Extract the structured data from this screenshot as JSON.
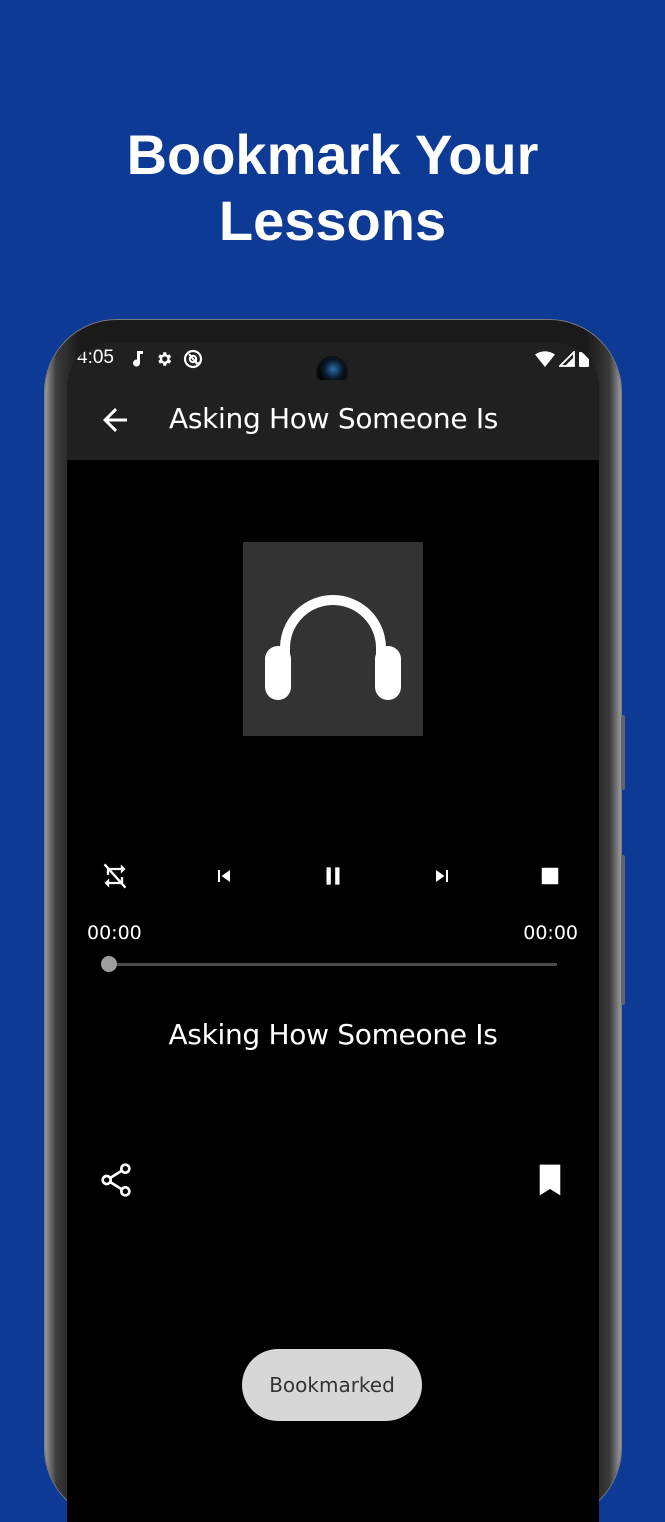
{
  "promo": {
    "headline_line1": "Bookmark Your",
    "headline_line2": "Lessons",
    "background_color": "#0c3a94"
  },
  "status_bar": {
    "time": "4:05",
    "left_icons": [
      "music-note-icon",
      "gear-icon",
      "at-sign-icon"
    ],
    "right_icons": [
      "wifi-icon",
      "cellular-signal-icon",
      "battery-icon"
    ]
  },
  "app_bar": {
    "back_icon": "arrow-left-icon",
    "title": "Asking How Someone Is"
  },
  "player": {
    "artwork_icon": "headphones-icon",
    "controls": [
      {
        "name": "repeat-off",
        "icon": "repeat-off-icon"
      },
      {
        "name": "previous",
        "icon": "skip-previous-icon"
      },
      {
        "name": "pause",
        "icon": "pause-icon"
      },
      {
        "name": "next",
        "icon": "skip-next-icon"
      },
      {
        "name": "stop",
        "icon": "stop-icon"
      }
    ],
    "elapsed": "00:00",
    "duration": "00:00",
    "progress_fraction": 0,
    "track_title": "Asking How Someone Is"
  },
  "actions": {
    "share_icon": "share-icon",
    "bookmark_icon": "bookmark-filled-icon"
  },
  "toast": {
    "message": "Bookmarked"
  }
}
